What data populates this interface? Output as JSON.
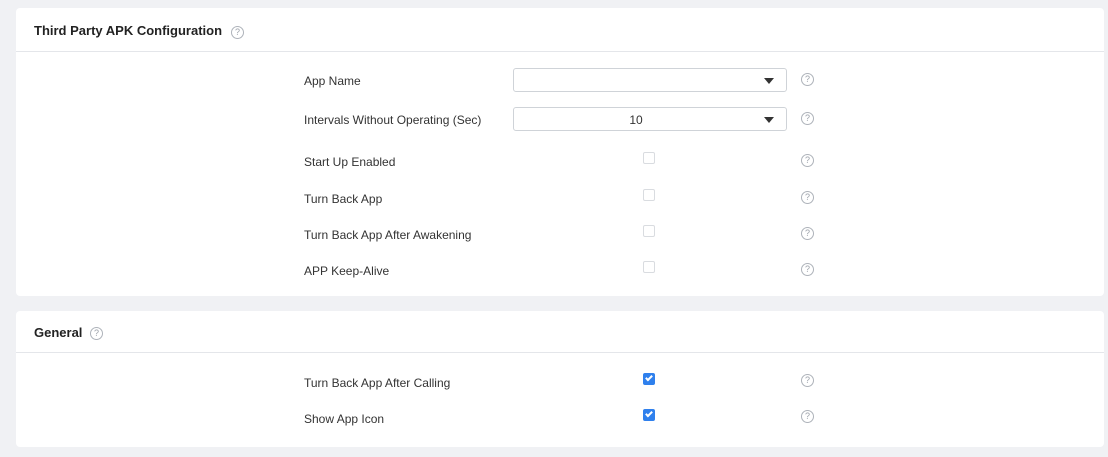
{
  "sections": {
    "apk": {
      "title": "Third Party APK Configuration",
      "help_icon": "question-circle-icon",
      "rows": [
        {
          "label": "App Name",
          "control": "select",
          "value": ""
        },
        {
          "label": "Intervals Without Operating (Sec)",
          "control": "select",
          "value": "10"
        },
        {
          "label": "Start Up Enabled",
          "control": "checkbox",
          "checked": false
        },
        {
          "label": "Turn Back App",
          "control": "checkbox",
          "checked": false
        },
        {
          "label": "Turn Back App After Awakening",
          "control": "checkbox",
          "checked": false
        },
        {
          "label": "APP Keep-Alive",
          "control": "checkbox",
          "checked": false
        }
      ]
    },
    "general": {
      "title": "General",
      "help_icon": "question-circle-icon",
      "rows": [
        {
          "label": "Turn Back App After Calling",
          "control": "checkbox",
          "checked": true
        },
        {
          "label": "Show App Icon",
          "control": "checkbox",
          "checked": true
        }
      ]
    }
  },
  "icons": {
    "help_glyph": "?",
    "dropdown": "caret-down-icon",
    "checkmark": "checkmark-icon"
  },
  "colors": {
    "page_background": "#f0f1f4",
    "panel_background": "#ffffff",
    "checkbox_checked": "#2f80ed",
    "divider": "#e4e6ea"
  }
}
